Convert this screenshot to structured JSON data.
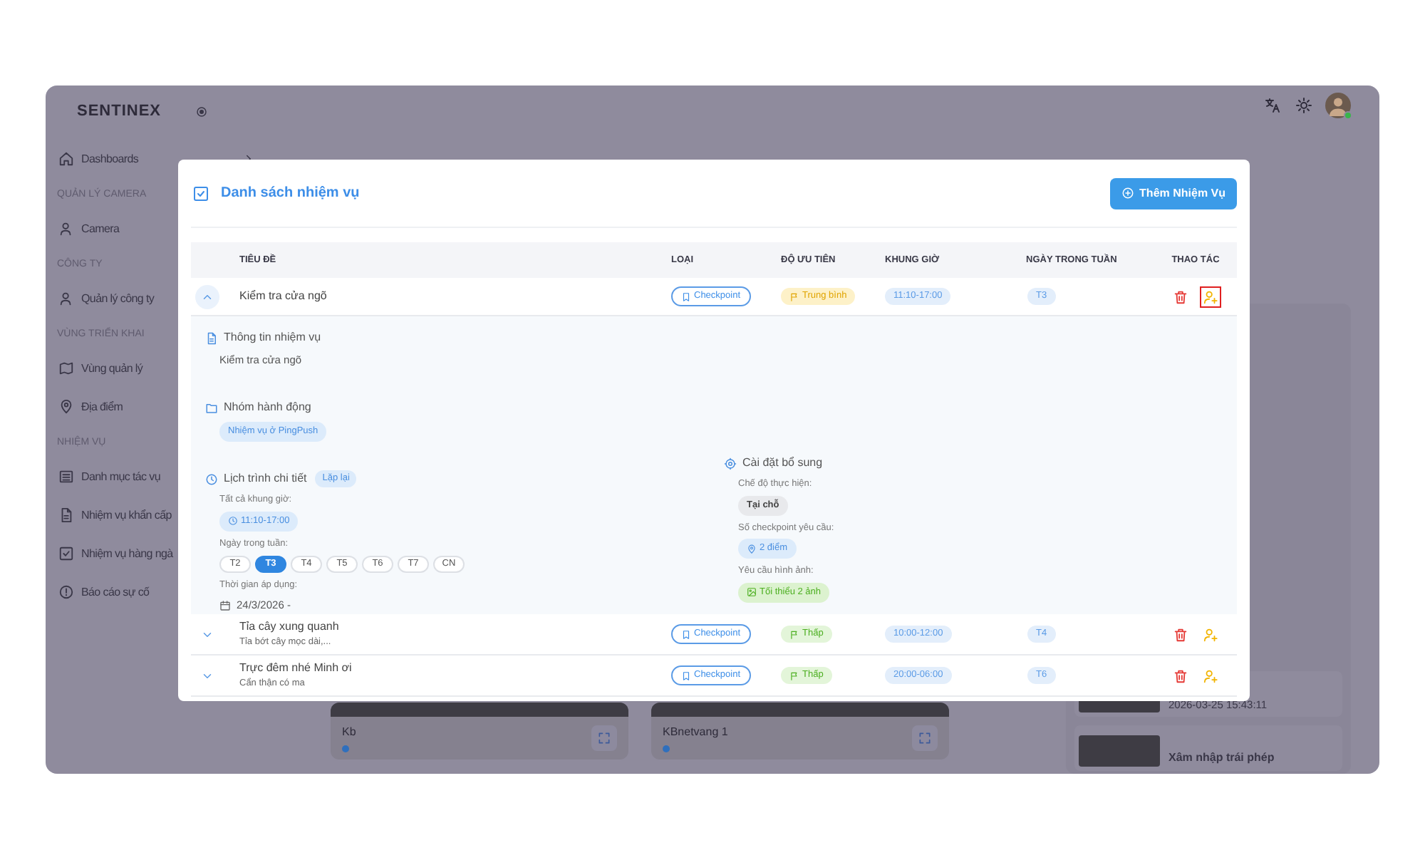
{
  "app": {
    "logo": "SENTINEX",
    "sidebar": [
      {
        "kind": "item",
        "label": "Dashboards",
        "chevron": true
      },
      {
        "kind": "section",
        "label": "QUẢN LÝ CAMERA"
      },
      {
        "kind": "item",
        "label": "Camera"
      },
      {
        "kind": "section",
        "label": "CÔNG TY"
      },
      {
        "kind": "item",
        "label": "Quản lý công ty"
      },
      {
        "kind": "section",
        "label": "VÙNG TRIỂN KHAI"
      },
      {
        "kind": "item",
        "label": "Vùng quản lý"
      },
      {
        "kind": "item",
        "label": "Địa điểm"
      },
      {
        "kind": "section",
        "label": "NHIỆM VỤ"
      },
      {
        "kind": "item",
        "label": "Danh mục tác vụ"
      },
      {
        "kind": "item",
        "label": "Nhiệm vụ khẩn cấp"
      },
      {
        "kind": "item",
        "label": "Nhiệm vụ hàng ngà"
      },
      {
        "kind": "item",
        "label": "Báo cáo sự cố"
      }
    ],
    "cameras": [
      {
        "name": "Kb"
      },
      {
        "name": "KBnetvang 1"
      }
    ],
    "events": [
      {
        "date": "2026-03-25 15:43:11"
      },
      {
        "title": "Xâm nhập trái phép"
      }
    ]
  },
  "modal": {
    "title": "Danh sách nhiệm vụ",
    "add_button": "Thêm Nhiệm Vụ",
    "columns": [
      "TIÊU ĐỀ",
      "LOẠI",
      "ĐỘ ƯU TIÊN",
      "KHUNG GIỜ",
      "NGÀY TRONG TUẦN",
      "THAO TÁC"
    ],
    "rows": [
      {
        "title": "Kiểm tra cửa ngõ",
        "type": "Checkpoint",
        "priority": {
          "kind": "medium",
          "label": "Trung bình"
        },
        "time": "11:10-17:00",
        "day": "T3",
        "expanded": true,
        "assign_focused": true,
        "detail": {
          "info_label": "Thông tin nhiệm vụ",
          "info_value": "Kiểm tra cửa ngõ",
          "group_label": "Nhóm hành động",
          "group_chip": "Nhiệm vụ ở PingPush",
          "schedule_label": "Lịch trình chi tiết",
          "schedule_badge": "Lặp lại",
          "slots_label": "Tất cả khung giờ:",
          "slot": "11:10-17:00",
          "days_label": "Ngày trong tuần:",
          "days": [
            {
              "label": "T2",
              "selected": false
            },
            {
              "label": "T3",
              "selected": true
            },
            {
              "label": "T4",
              "selected": false
            },
            {
              "label": "T5",
              "selected": false
            },
            {
              "label": "T6",
              "selected": false
            },
            {
              "label": "T7",
              "selected": false
            },
            {
              "label": "CN",
              "selected": false
            }
          ],
          "apply_label": "Thời gian áp dụng:",
          "apply_value": "24/3/2026 -",
          "settings_label": "Cài đặt bổ sung",
          "mode_label": "Chế độ thực hiện:",
          "mode": "Tại chỗ",
          "checkpoints_label": "Số checkpoint yêu cầu:",
          "checkpoints": "2 điểm",
          "images_label": "Yêu cầu hình ảnh:",
          "images": "Tối thiểu 2 ảnh"
        }
      },
      {
        "title": "Tỉa cây xung quanh",
        "subtitle": "Tỉa bớt cây mọc dài,...",
        "type": "Checkpoint",
        "priority": {
          "kind": "low",
          "label": "Thấp"
        },
        "time": "10:00-12:00",
        "day": "T4",
        "expanded": false,
        "assign_focused": false
      },
      {
        "title": "Trực đêm nhé Minh ơi",
        "subtitle": "Cẩn thận có ma",
        "type": "Checkpoint",
        "priority": {
          "kind": "low",
          "label": "Thấp"
        },
        "time": "20:00-06:00",
        "day": "T6",
        "expanded": false,
        "assign_focused": false
      }
    ]
  }
}
